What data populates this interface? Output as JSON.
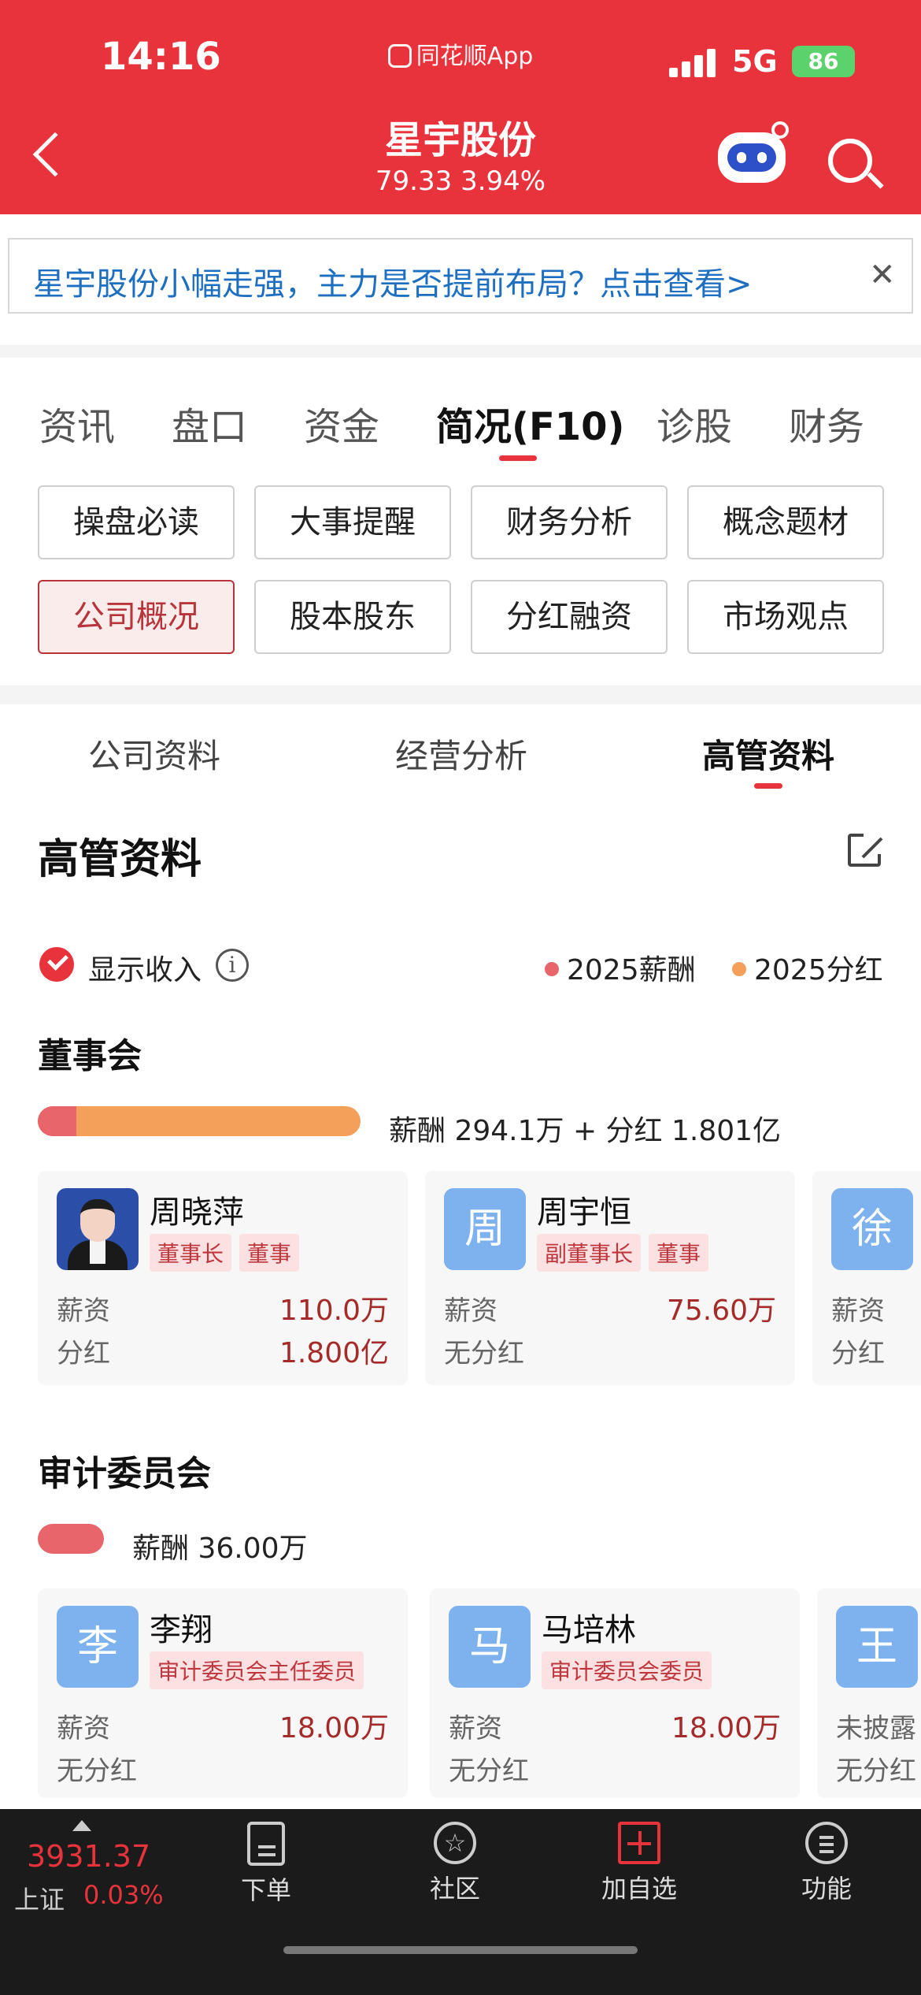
{
  "status": {
    "time": "14:16",
    "app": "同花顺App",
    "network": "5G",
    "battery": "86"
  },
  "header": {
    "title": "星宇股份",
    "price": "79.33",
    "change": "3.94%"
  },
  "banner": {
    "text": "星宇股份小幅走强，主力是否提前布局？点击查看>",
    "close": "✕"
  },
  "main_tabs": [
    "资讯",
    "盘口",
    "资金",
    "简况(F10)",
    "诊股",
    "财务"
  ],
  "grid_buttons": [
    "操盘必读",
    "大事提醒",
    "财务分析",
    "概念题材",
    "公司概况",
    "股本股东",
    "分红融资",
    "市场观点"
  ],
  "sub_tabs": [
    "公司资料",
    "经营分析",
    "高管资料"
  ],
  "section_title": "高管资料",
  "options": {
    "show_income": "显示收入",
    "info": "i",
    "legend_salary": "2025薪酬",
    "legend_dividend": "2025分红"
  },
  "colors": {
    "accent": "#e8333d",
    "salary": "#e8656b",
    "dividend": "#f5a05a"
  },
  "board": {
    "title": "董事会",
    "summary": "薪酬 294.1万 + 分红 1.801亿",
    "salary_fraction": 0.12,
    "cards": [
      {
        "avatar": "",
        "name": "周晓萍",
        "tags": [
          "董事长",
          "董事"
        ],
        "salary_label": "薪资",
        "salary": "110.0万",
        "dividend_label": "分红",
        "dividend": "1.800亿"
      },
      {
        "avatar": "周",
        "name": "周宇恒",
        "tags": [
          "副董事长",
          "董事"
        ],
        "salary_label": "薪资",
        "salary": "75.60万",
        "dividend_label": "无分红",
        "dividend": ""
      },
      {
        "avatar": "徐",
        "name": "",
        "tags": [],
        "salary_label": "薪资",
        "salary": "",
        "dividend_label": "分红",
        "dividend": ""
      }
    ]
  },
  "audit": {
    "title": "审计委员会",
    "summary": "薪酬 36.00万",
    "cards": [
      {
        "avatar": "李",
        "name": "李翔",
        "tags": [
          "审计委员会主任委员"
        ],
        "salary_label": "薪资",
        "salary": "18.00万",
        "dividend_label": "无分红"
      },
      {
        "avatar": "马",
        "name": "马培林",
        "tags": [
          "审计委员会委员"
        ],
        "salary_label": "薪资",
        "salary": "18.00万",
        "dividend_label": "无分红"
      },
      {
        "avatar": "王",
        "name": "",
        "tags": [],
        "salary_label": "未披露",
        "salary": "",
        "dividend_label": "无分红"
      }
    ]
  },
  "bottom": {
    "index_value": "3931.37",
    "index_name": "上证",
    "index_change": "0.03%",
    "nav": [
      {
        "icon": "document-icon",
        "label": "下单"
      },
      {
        "icon": "star-circle-icon",
        "label": "社区"
      },
      {
        "icon": "plus-square-icon",
        "label": "加自选"
      },
      {
        "icon": "menu-circle-icon",
        "label": "功能"
      }
    ]
  }
}
